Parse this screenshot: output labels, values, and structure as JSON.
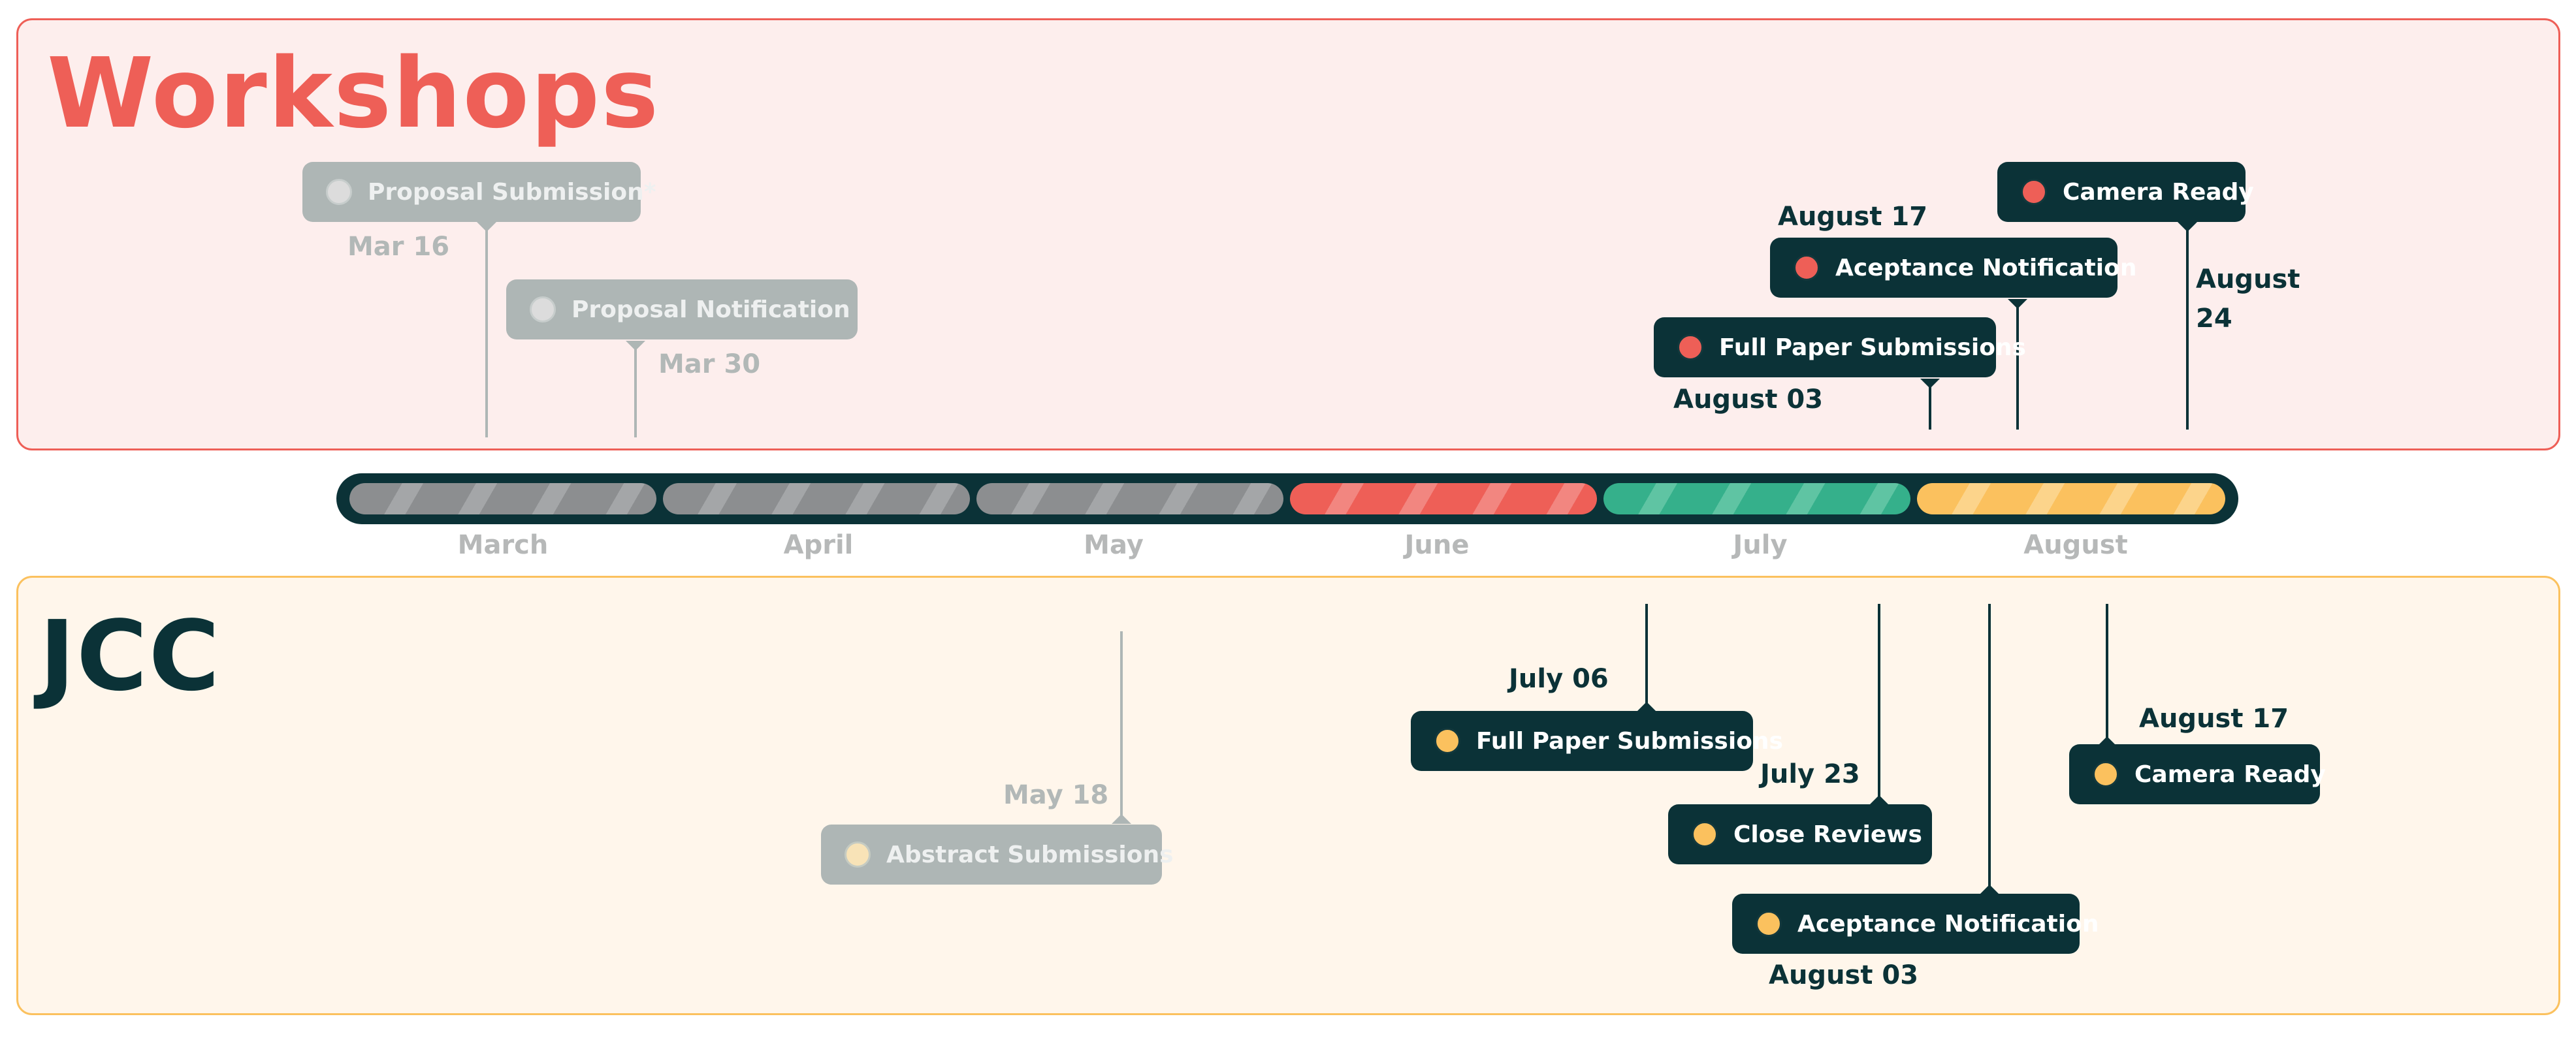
{
  "workshops": {
    "title": "Workshops",
    "milestones": [
      {
        "label": "Proposal Submission*",
        "date": "Mar 16"
      },
      {
        "label": "Proposal Notification",
        "date": "Mar 30"
      },
      {
        "label": "Full Paper Submissions",
        "date": "August 03"
      },
      {
        "label": "Aceptance Notification",
        "date": "August 17"
      },
      {
        "label": "Camera Ready",
        "date": "August\n24"
      }
    ]
  },
  "timeline": {
    "months": [
      "March",
      "April",
      "May",
      "June",
      "July",
      "August"
    ],
    "colors": {
      "past": "#8c8e90",
      "june": "#ee5f57",
      "july": "#35b08b",
      "august": "#fbc15e",
      "track": "#0b3237"
    }
  },
  "jcc": {
    "title": "JCC",
    "milestones": [
      {
        "label": "Abstract  Submissions",
        "date": "May 18"
      },
      {
        "label": "Full Paper Submissions",
        "date": "July  06"
      },
      {
        "label": "Close Reviews",
        "date": "July 23"
      },
      {
        "label": "Aceptance Notification",
        "date": "August 03"
      },
      {
        "label": "Camera Ready",
        "date": "August 17"
      }
    ]
  },
  "colors": {
    "workshops_accent": "#ee5f57",
    "workshops_bg": "#fdeeed",
    "jcc_accent": "#fbc15e",
    "jcc_bg": "#fff6eb",
    "dark": "#0b3237",
    "inactive": "#aeb6b5"
  }
}
